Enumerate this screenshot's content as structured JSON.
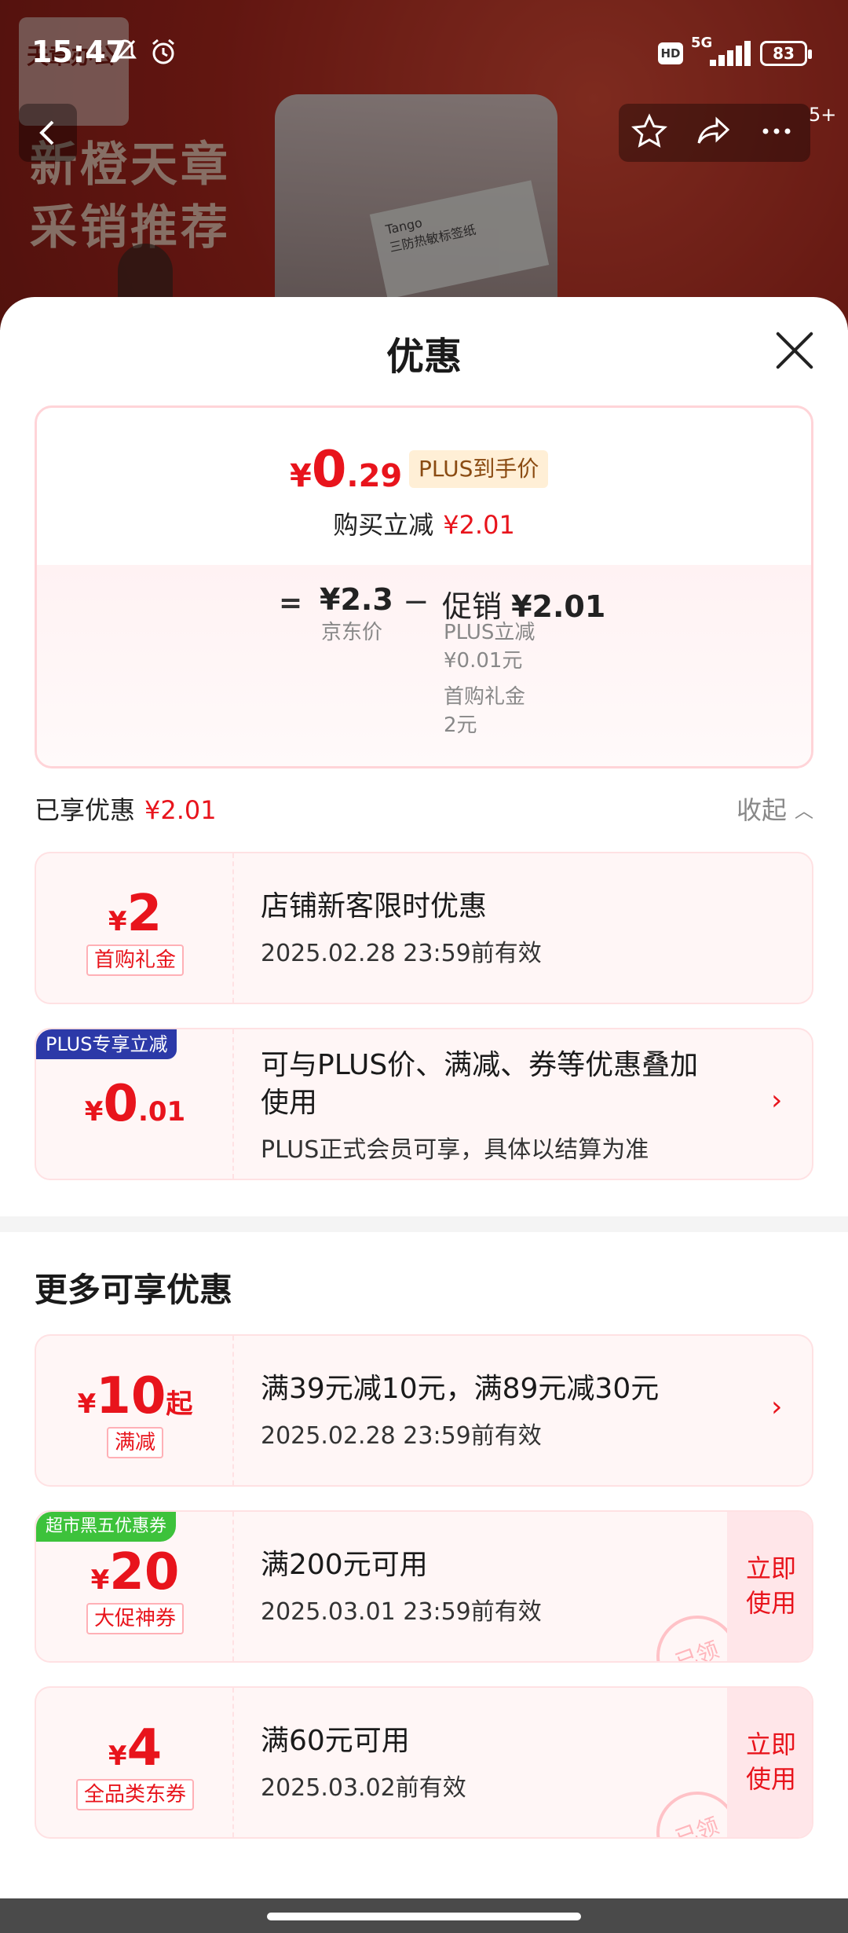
{
  "status_bar": {
    "time": "15:47",
    "network": "5G",
    "hd": "HD",
    "battery": "83"
  },
  "background": {
    "logo_text": "天章办公",
    "headline": "新橙天章\n采销推荐",
    "label_text": "Tango\n三防热敏标签纸"
  },
  "nav": {
    "badge": "5+"
  },
  "sheet": {
    "title": "优惠"
  },
  "price_summary": {
    "symbol": "¥",
    "final_int": "0",
    "final_dec": ".29",
    "plus_tag": "PLUS到手价",
    "reduce_label": "购买立减",
    "reduce_value": "¥2.01",
    "equals": "=",
    "jd_price": "¥2.3",
    "jd_price_label": "京东价",
    "minus": "−",
    "promo_label": "促销",
    "promo_value": "¥2.01",
    "detail_1_label": "PLUS立减",
    "detail_1_value": "¥0.01元",
    "detail_2_label": "首购礼金",
    "detail_2_value": "2元"
  },
  "enjoyed": {
    "label": "已享优惠",
    "value": "¥2.01",
    "collapse": "收起"
  },
  "enjoyed_coupons": [
    {
      "symbol": "¥",
      "amount": "2",
      "tag": "首购礼金",
      "title": "店铺新客限时优惠",
      "subtitle": "2025.02.28 23:59前有效"
    },
    {
      "corner": "PLUS专享立减",
      "symbol": "¥",
      "amount": "0",
      "decimal": ".01",
      "title": "可与PLUS价、满减、券等优惠叠加\n使用",
      "subtitle": "PLUS正式会员可享，具体以结算为准"
    }
  ],
  "more": {
    "title": "更多可享优惠"
  },
  "more_coupons": [
    {
      "symbol": "¥",
      "amount": "10",
      "suffix": "起",
      "tag": "满减",
      "title": "满39元减10元，满89元减30元",
      "subtitle": "2025.02.28 23:59前有效"
    },
    {
      "corner": "超市黑五优惠券",
      "symbol": "¥",
      "amount": "20",
      "tag": "大促神券",
      "title": "满200元可用",
      "subtitle": "2025.03.01 23:59前有效",
      "action": "立即\n使用",
      "stamp": "已领"
    },
    {
      "symbol": "¥",
      "amount": "4",
      "tag": "全品类东券",
      "title": "满60元可用",
      "subtitle": "2025.03.02前有效",
      "action": "立即\n使用",
      "stamp": "已领"
    }
  ],
  "colors": {
    "accent": "#e8141c",
    "plus_blue": "#2c39a8",
    "green_tag": "#3dc23b"
  }
}
